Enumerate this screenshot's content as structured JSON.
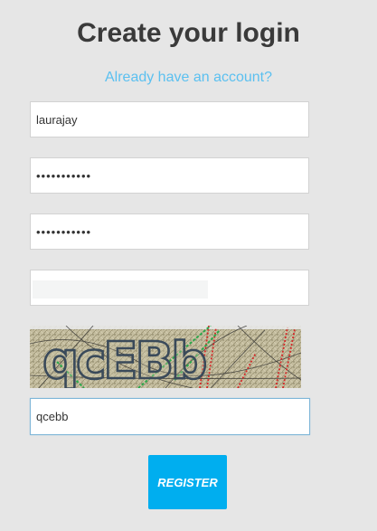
{
  "header": {
    "title": "Create your login",
    "signin_link": "Already have an account?"
  },
  "form": {
    "username_value": "laurajay",
    "password_value": "•••••••••••",
    "confirm_password_value": "•••••••••••",
    "email_value": "",
    "captcha_value": "qcebb"
  },
  "captcha": {
    "image_text": "qcEBb"
  },
  "actions": {
    "register_label": "REGISTER"
  },
  "colors": {
    "accent": "#00aeef",
    "link": "#5bc0f0",
    "title": "#3a3a3a",
    "background": "#e6e6e6"
  }
}
